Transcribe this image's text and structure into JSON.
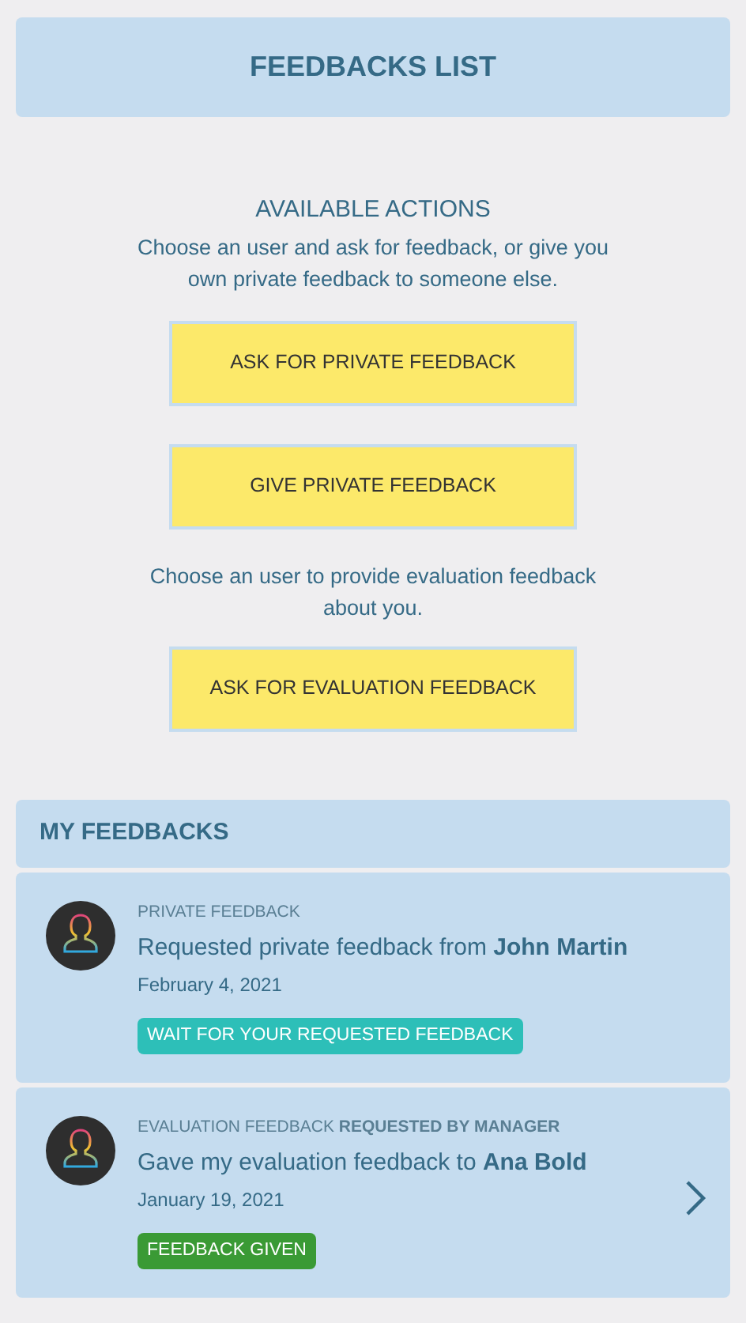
{
  "header": {
    "title": "FEEDBACKS LIST"
  },
  "actions": {
    "title": "AVAILABLE ACTIONS",
    "description": "Choose an user and ask for feedback, or give you own private feedback to someone else.",
    "groups": [
      {
        "buttons": [
          "ASK FOR PRIVATE FEEDBACK",
          "GIVE PRIVATE FEEDBACK"
        ]
      },
      {
        "description": "Choose an user to provide evaluation feedback about you.",
        "buttons": [
          "ASK FOR EVALUATION FEEDBACK"
        ]
      }
    ]
  },
  "my_feedbacks": {
    "title": "MY FEEDBACKS",
    "items": [
      {
        "category": "PRIVATE FEEDBACK",
        "title": "Requested private feedback from **John Martin**",
        "date": "February 4, 2021",
        "status": "WAIT FOR YOUR REQUESTED FEEDBACK",
        "color": "#2dbfb8",
        "has_details": false
      },
      {
        "category": "EVALUATION FEEDBACK **REQUESTED BY MANAGER**",
        "title": "Gave my evaluation feedback to **Ana Bold**",
        "date": "January 19, 2021",
        "status": "FEEDBACK GIVEN",
        "color": "#3a9a35",
        "has_details": true
      }
    ]
  }
}
